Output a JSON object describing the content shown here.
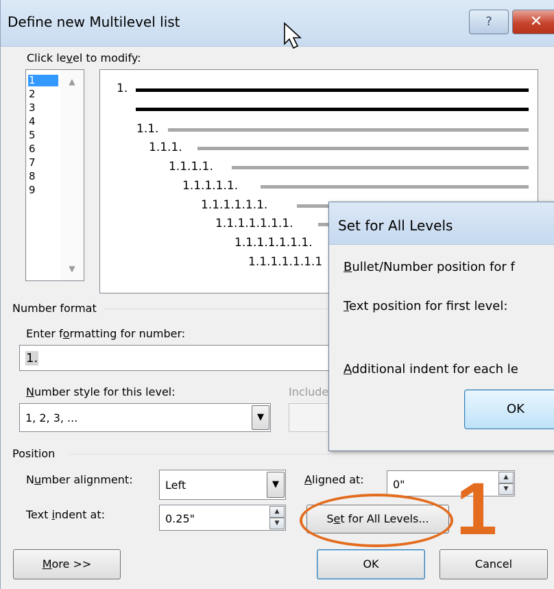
{
  "dialog": {
    "title": "Define new Multilevel list",
    "help_button": "?",
    "close_button": "✕"
  },
  "level_list": {
    "label_pre": "Click le",
    "label_acc": "v",
    "label_post": "el to modify:",
    "items": [
      "1",
      "2",
      "3",
      "4",
      "5",
      "6",
      "7",
      "8",
      "9"
    ],
    "selected": "1"
  },
  "preview": {
    "lines": [
      "1.",
      "1.1.",
      "1.1.1.",
      "1.1.1.1.",
      "1.1.1.1.1.",
      "1.1.1.1.1.1.",
      "1.1.1.1.1.1.1.",
      "1.1.1.1.1.1.1.",
      "1.1.1.1.1.1.1"
    ]
  },
  "number_format": {
    "section_label": "Number format",
    "enter_label_pre": "Enter f",
    "enter_label_acc": "o",
    "enter_label_post": "rmatting for number:",
    "format_value": "1.",
    "style_label_acc": "N",
    "style_label_post": "umber style for this level:",
    "style_value": "1, 2, 3, ...",
    "include_label": "Include"
  },
  "position": {
    "section_label": "Position",
    "alignment_label_pre": "N",
    "alignment_label_acc": "u",
    "alignment_label_post": "mber alignment:",
    "alignment_value": "Left",
    "aligned_at_label_acc": "A",
    "aligned_at_label_post": "ligned at:",
    "aligned_at_value": "0\"",
    "text_indent_label_pre": "Text ",
    "text_indent_label_acc": "i",
    "text_indent_label_post": "ndent at:",
    "text_indent_value": "0.25\"",
    "set_all_label_pre": "S",
    "set_all_label_acc": "e",
    "set_all_label_post": "t for All Levels..."
  },
  "footer": {
    "more_acc": "M",
    "more_post": "ore >>",
    "ok": "OK",
    "cancel": "Cancel"
  },
  "set_all_dialog": {
    "title": "Set for All Levels",
    "bullet_acc": "B",
    "bullet_post": "ullet/Number position for f",
    "text_acc": "T",
    "text_post": "ext position for first level:",
    "indent_acc": "A",
    "indent_post": "dditional indent for each le",
    "ok": "OK"
  },
  "annotation": {
    "step_number": "1",
    "color": "#e36c1f"
  }
}
